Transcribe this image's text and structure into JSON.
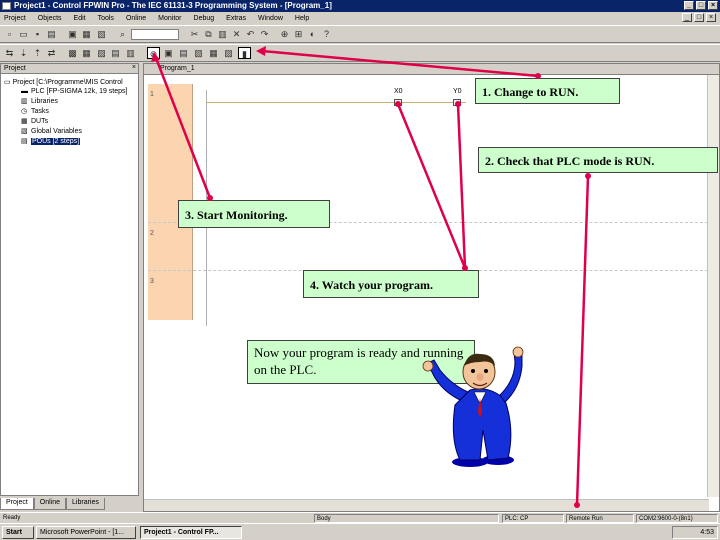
{
  "window": {
    "title": "Project1 - Control FPWIN Pro - The IEC 61131-3 Programming System - [Program_1]"
  },
  "menu": {
    "items": [
      "Project",
      "Objects",
      "Edit",
      "Tools",
      "Online",
      "Monitor",
      "Debug",
      "Extras",
      "Window",
      "Help"
    ]
  },
  "project_pane": {
    "title": "Project",
    "root": "Project [C:\\Programme\\MIS Control",
    "items": [
      {
        "label": "PLC [FP-SIGMA 12k, 19 steps]",
        "icon": "plc-icon"
      },
      {
        "label": "Libraries",
        "icon": "libraries-icon"
      },
      {
        "label": "Tasks",
        "icon": "tasks-icon"
      },
      {
        "label": "DUTs",
        "icon": "duts-icon"
      },
      {
        "label": "Global Variables",
        "icon": "global-variables-icon"
      },
      {
        "label": "POUs [2 steps]",
        "icon": "pous-icon"
      }
    ],
    "tabs": [
      "Project",
      "Online",
      "Libraries"
    ]
  },
  "editor": {
    "tab_title": "Program_1",
    "rung_numbers": [
      "1",
      "2",
      "3"
    ],
    "contact1": "X0",
    "coil1": "Y0"
  },
  "callouts": {
    "step1": "1. Change to RUN.",
    "step2": "2. Check that PLC mode is RUN.",
    "step3": "3. Start Monitoring.",
    "step4": "4. Watch your program.",
    "final": "Now your program is ready and running on the PLC."
  },
  "statusbar": {
    "ready": "Ready",
    "body": "Body",
    "plc": "PLC: CP",
    "mode": "Remote Run",
    "comm": "COM2:9600-0-(8n1)"
  },
  "taskbar": {
    "start": "Start",
    "task1": "Microsoft PowerPoint - [1...",
    "task2": "Project1 - Control FP...",
    "clock": "4:53"
  },
  "colors": {
    "callout_bg": "#ccffcc",
    "arrow": "#e0004a",
    "titlebar": "#0a246a",
    "ladder_strip": "#fbd4b0"
  }
}
